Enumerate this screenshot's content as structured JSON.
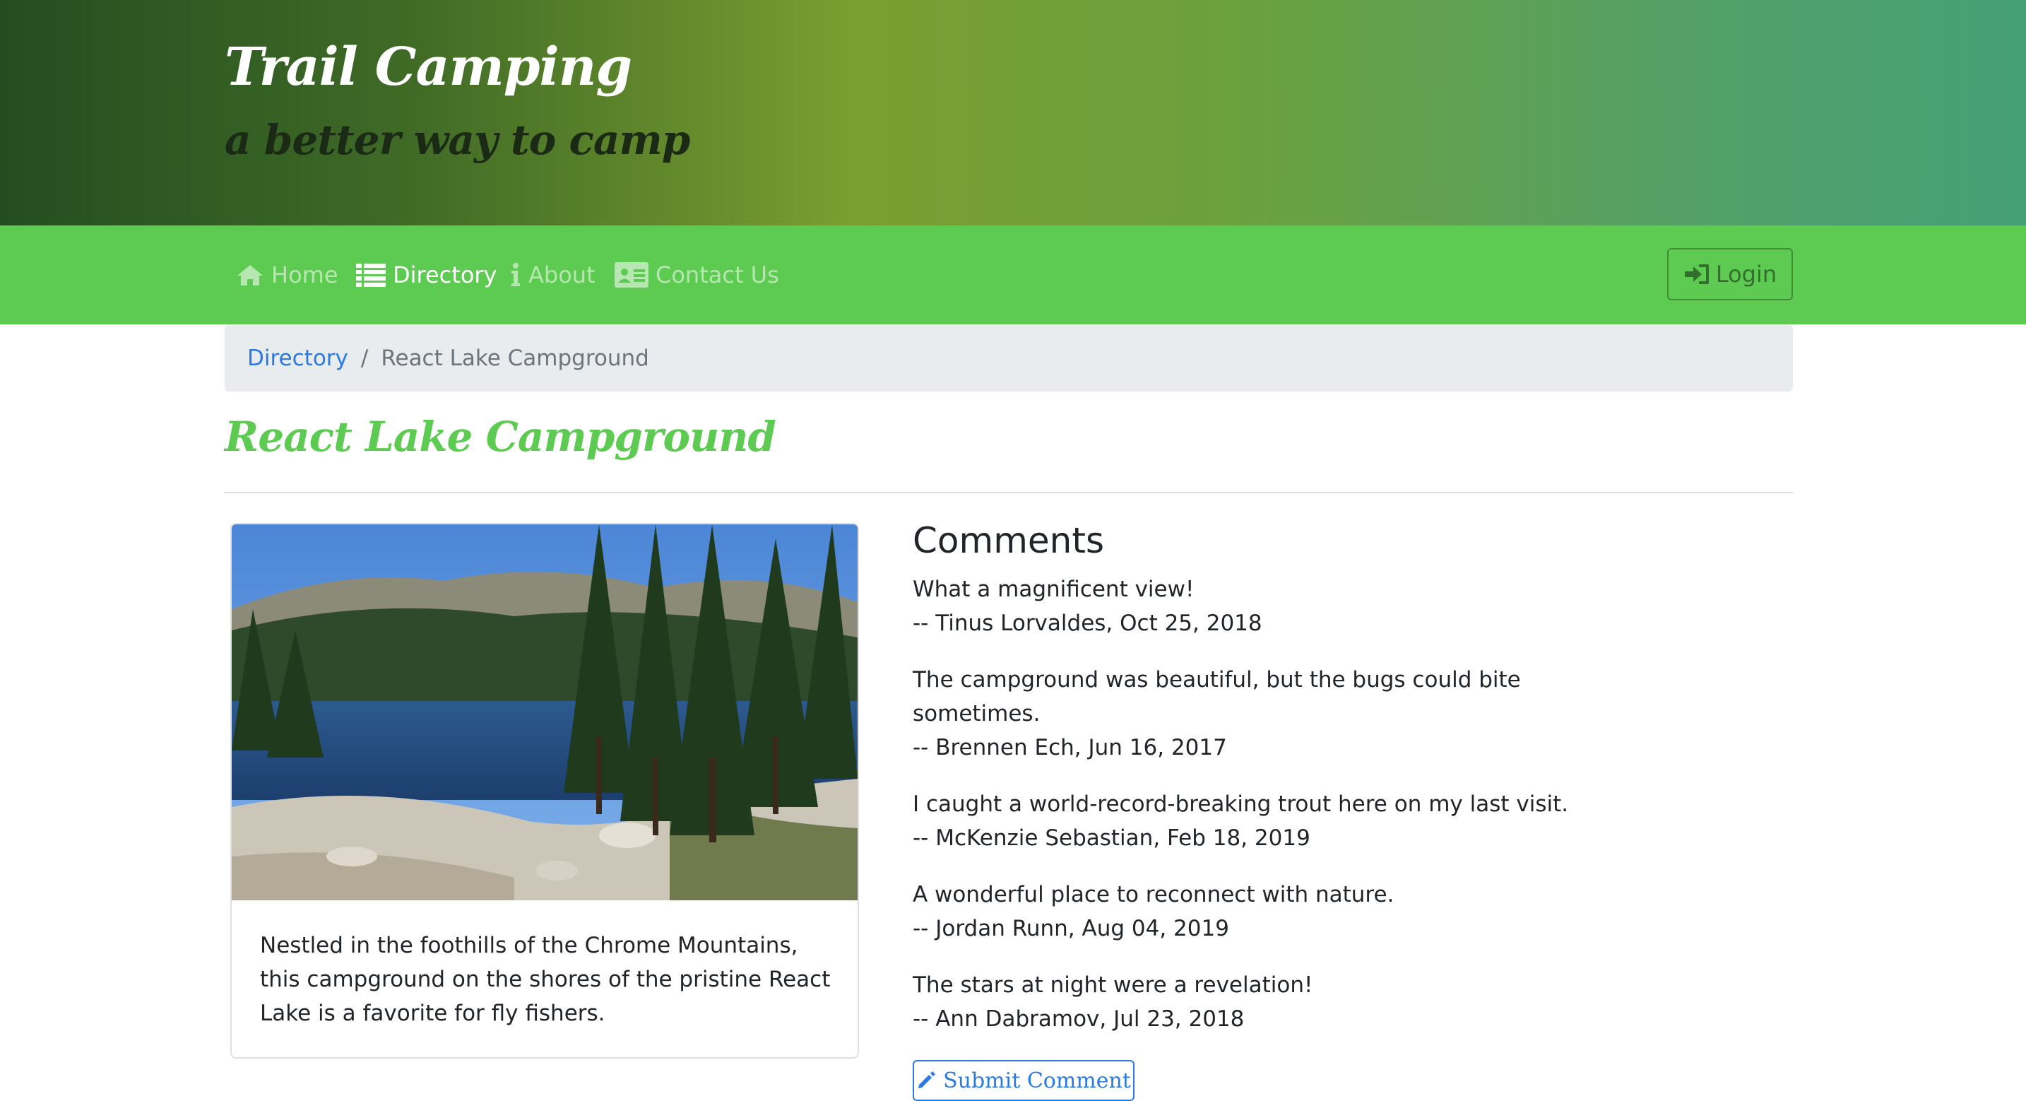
{
  "header": {
    "title": "Trail Camping",
    "tagline": "a better way to camp"
  },
  "nav": {
    "items": [
      {
        "label": "Home",
        "icon": "home-icon"
      },
      {
        "label": "Directory",
        "icon": "list-icon",
        "active": true
      },
      {
        "label": "About",
        "icon": "info-icon"
      },
      {
        "label": "Contact Us",
        "icon": "address-card-icon"
      }
    ],
    "login_label": "Login",
    "login_icon": "sign-in-icon"
  },
  "breadcrumb": {
    "link": "Directory",
    "separator": "/",
    "active": "React Lake Campground"
  },
  "campsite": {
    "name": "React Lake Campground",
    "photo": "lake-with-pine-trees-photo",
    "description": "Nestled in the foothills of the Chrome Mountains, this campground on the shores of the pristine React Lake is a favorite for fly fishers."
  },
  "comments": {
    "heading": "Comments",
    "items": [
      {
        "text": "What a magnificent view!",
        "byline": "-- Tinus Lorvaldes, Oct 25, 2018"
      },
      {
        "text": "The campground was beautiful, but the bugs could bite sometimes.",
        "byline": "-- Brennen Ech, Jun 16, 2017"
      },
      {
        "text": "I caught a world-record-breaking trout here on my last visit.",
        "byline": "-- McKenzie Sebastian, Feb 18, 2019"
      },
      {
        "text": "A wonderful place to reconnect with nature.",
        "byline": "-- Jordan Runn, Aug 04, 2019"
      },
      {
        "text": "The stars at night were a revelation!",
        "byline": "-- Ann Dabramov, Jul 23, 2018"
      }
    ],
    "submit_label": "Submit Comment",
    "submit_icon": "pencil-icon"
  },
  "colors": {
    "navbar": "#5dca51",
    "title_green": "#5dca51",
    "link_blue": "#2a7ae2",
    "breadcrumb_bg": "#e9ecef"
  }
}
